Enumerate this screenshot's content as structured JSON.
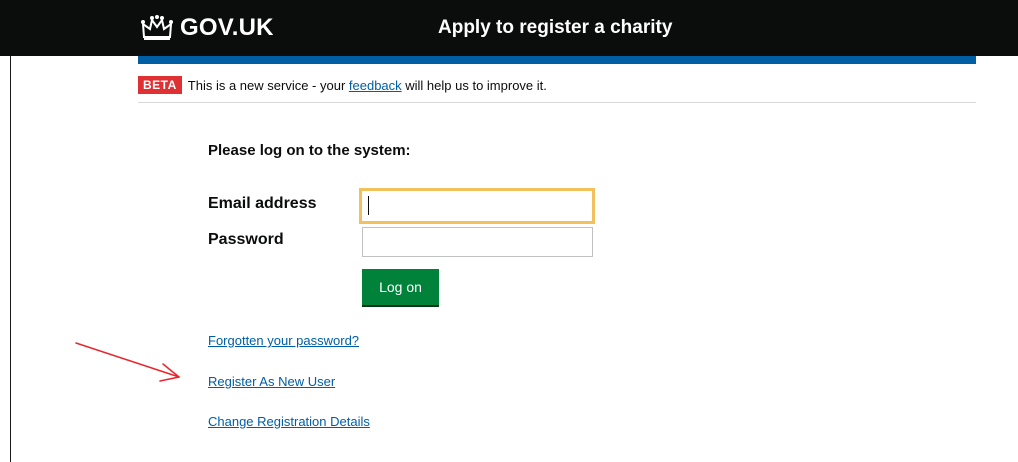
{
  "header": {
    "logo_text": "GOV.UK",
    "service_name": "Apply to register a charity",
    "icons": {
      "logo": "crown-icon"
    }
  },
  "phase_banner": {
    "tag": "BETA",
    "text_before": "This is a new service - your ",
    "link_text": "feedback",
    "text_after": " will help us to improve it."
  },
  "login": {
    "heading": "Please log on to the system:",
    "email_label": "Email address",
    "email_value": "",
    "password_label": "Password",
    "password_value": "",
    "button_label": "Log on"
  },
  "links": {
    "forgot_password": "Forgotten your password?",
    "register_new_user": "Register As New User",
    "change_registration": "Change Registration Details"
  },
  "annotation": {
    "icon": "red-arrow-annotation"
  },
  "colors": {
    "header_bg": "#0b0c0c",
    "blue_bar": "#005ea5",
    "beta_tag": "#df3034",
    "link": "#005ea5",
    "focus": "#f2c15b",
    "button": "#00823b",
    "arrow": "#e8262d"
  }
}
